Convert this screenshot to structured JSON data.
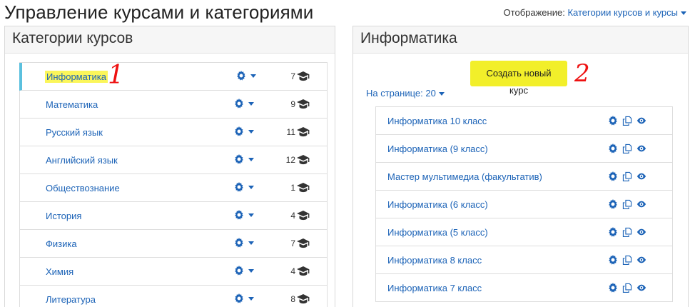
{
  "header": {
    "title": "Управление курсами и категориями",
    "view_label": "Отображение:",
    "view_value": "Категории курсов и курсы"
  },
  "categories_panel": {
    "title": "Категории курсов",
    "items": [
      {
        "label": "Информатика",
        "count": "7",
        "active": true
      },
      {
        "label": "Математика",
        "count": "9"
      },
      {
        "label": "Русский язык",
        "count": "11"
      },
      {
        "label": "Английский язык",
        "count": "12"
      },
      {
        "label": "Обществознание",
        "count": "1"
      },
      {
        "label": "История",
        "count": "4"
      },
      {
        "label": "Физика",
        "count": "7"
      },
      {
        "label": "Химия",
        "count": "4"
      },
      {
        "label": "Литература",
        "count": "8"
      }
    ]
  },
  "courses_panel": {
    "title": "Информатика",
    "create_button": "Создать новый курс",
    "per_page": "На странице: 20",
    "courses": [
      "Информатика 10 класс",
      "Информатика (9 класс)",
      "Мастер мультимедиа (факультатив)",
      "Информатика (6 класс)",
      "Информатика (5 класс)",
      "Информатика 8 класс",
      "Информатика 7 класс"
    ]
  },
  "annotations": {
    "mark1": "1",
    "mark2": "2"
  },
  "colors": {
    "link": "#1c63b7",
    "highlight": "#fbf65a",
    "active_bar": "#5bc0de",
    "annotation": "#e11111"
  },
  "icons": {
    "gear": "gear-icon",
    "cap": "graduation-cap-icon",
    "copy": "copy-icon",
    "eye": "eye-icon"
  }
}
